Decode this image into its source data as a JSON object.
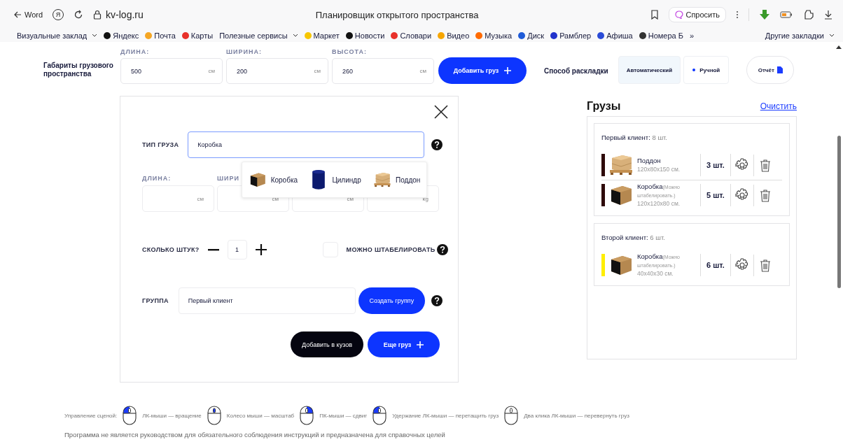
{
  "browser": {
    "back_label": "Word",
    "yandex_glyph": "Я",
    "url": "kv-log.ru",
    "title": "Планировщик открытого пространства",
    "ask_button": "Спросить",
    "bookmarks": [
      {
        "label": "Визуальные заклад",
        "has_menu": true
      },
      {
        "label": "Яндекс",
        "color": "#111111",
        "has_menu": false
      },
      {
        "label": "Почта",
        "color": "#f5a623",
        "has_menu": false
      },
      {
        "label": "Карты",
        "color": "#e8312a",
        "has_menu": false
      },
      {
        "label": "Полезные сервисы",
        "has_menu": true
      },
      {
        "label": "Маркет",
        "color": "#f7c600",
        "has_menu": false
      },
      {
        "label": "Новости",
        "color": "#111111",
        "has_menu": false
      },
      {
        "label": "Словари",
        "color": "#e8312a",
        "has_menu": false
      },
      {
        "label": "Видео",
        "color": "#f7a600",
        "has_menu": false
      },
      {
        "label": "Музыка",
        "color": "#ff6a00",
        "has_menu": false
      },
      {
        "label": "Диск",
        "color": "#1e5bd8",
        "has_menu": false
      },
      {
        "label": "Рамблер",
        "color": "#2233cc",
        "has_menu": false
      },
      {
        "label": "Афиша",
        "color": "#2a4bd7",
        "has_menu": false
      },
      {
        "label": "Номера Б",
        "color": "#333333",
        "has_menu": false
      },
      {
        "label": "»",
        "has_menu": false
      }
    ],
    "other_bookmarks": "Другие закладки"
  },
  "space": {
    "label": "Габариты грузового пространства",
    "fields": [
      {
        "label": "ДЛИНА:",
        "value": "500",
        "unit": "см"
      },
      {
        "label": "ШИРИНА:",
        "value": "200",
        "unit": "см"
      },
      {
        "label": "ВЫСОТА:",
        "value": "260",
        "unit": "см"
      }
    ],
    "add_button": "Добавить груз",
    "mode_label": "Способ раскладки",
    "modes": [
      {
        "label": "Автоматический",
        "selected": true
      },
      {
        "label": "Ручной",
        "selected": false
      }
    ],
    "report_button": "Отчёт"
  },
  "dialog": {
    "type_label": "ТИП ГРУЗА",
    "type_value": "Коробка",
    "type_options": [
      {
        "kind": "box",
        "label": "Коробка"
      },
      {
        "kind": "cylinder",
        "label": "Цилиндр"
      },
      {
        "kind": "pallet",
        "label": "Поддон"
      }
    ],
    "size_fields": [
      {
        "label": "ДЛИНА:",
        "unit": "см"
      },
      {
        "label": "ШИРИ",
        "unit": "см"
      },
      {
        "unit": "см"
      },
      {
        "unit": "kg"
      }
    ],
    "count_label": "СКОЛЬКО ШТУК?",
    "count_value": "1",
    "stackable_label": "МОЖНО ШТАБЕЛИРОВАТЬ",
    "stackable": false,
    "group_label": "ГРУППА",
    "group_value": "Первый клиент",
    "create_group_button": "Создать группу",
    "add_to_body_button": "Добавить в кузов",
    "more_button": "Еще груз"
  },
  "cargo": {
    "title": "Грузы",
    "clear_link": "Очистить",
    "groups": [
      {
        "name": "Первый клиент:",
        "count": "8 шт.",
        "items": [
          {
            "kind": "pallet",
            "color": "#2e0a0a",
            "name": "Поддон",
            "dims": "120x80x150 см.",
            "qty": "3 шт."
          },
          {
            "kind": "box",
            "color": "#2e0a0a",
            "name": "Коробка",
            "note": "(Можно штабелировать.)",
            "dims": "120x120x80 см.",
            "qty": "5 шт."
          }
        ]
      },
      {
        "name": "Второй клиент:",
        "count": "6 шт.",
        "items": [
          {
            "kind": "box",
            "color": "#ffee00",
            "name": "Коробка",
            "note": "(Можно штабелировать.)",
            "dims": "40x40x30 см.",
            "qty": "6 шт."
          }
        ]
      }
    ]
  },
  "footer": {
    "controls_label": "Управление сценой:",
    "hints": [
      {
        "kind": "left",
        "text": "ЛК-мыши — вращение"
      },
      {
        "kind": "wheel",
        "text": "Колесо мыши — масштаб"
      },
      {
        "kind": "right",
        "text": "ПК-мыши — сдвиг"
      },
      {
        "kind": "left",
        "text": "Удержание ЛК-мыши — перетащить груз"
      },
      {
        "kind": "none",
        "text": "Два клика ЛК-мыши — перевернуть груз"
      }
    ],
    "disclaimer": "Программа не является руководством для обязательного соблюдения инструкций и предназначена для справочных целей"
  }
}
